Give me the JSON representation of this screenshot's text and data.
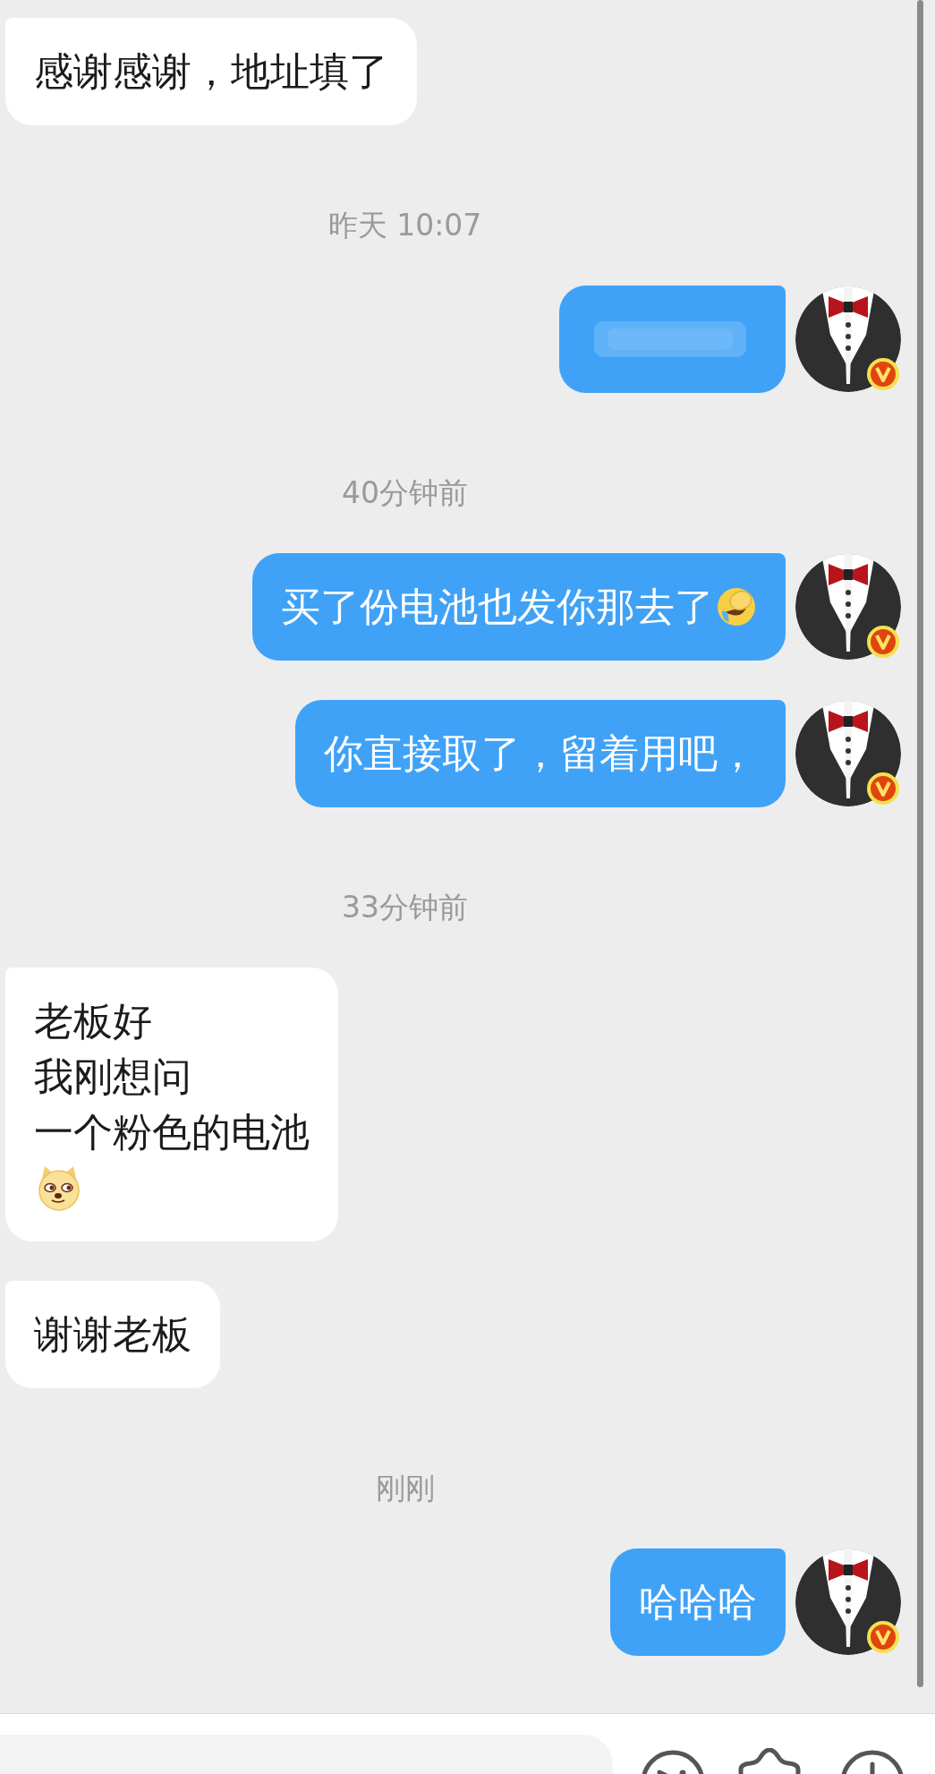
{
  "messages": [
    {
      "kind": "received",
      "blurred": false,
      "lines": [
        {
          "parts": [
            {
              "kind": "text",
              "text": "感谢感谢，地址填了"
            }
          ]
        }
      ]
    },
    {
      "kind": "time",
      "text": "昨天 10:07"
    },
    {
      "kind": "sent",
      "blurred": true
    },
    {
      "kind": "time",
      "text": "40分钟前"
    },
    {
      "kind": "sent",
      "blurred": false,
      "lines": [
        {
          "parts": [
            {
              "kind": "text",
              "text": "买了份电池也发你那去了"
            },
            {
              "kind": "laughing"
            }
          ]
        }
      ]
    },
    {
      "kind": "sent",
      "blurred": false,
      "lines": [
        {
          "parts": [
            {
              "kind": "text",
              "text": "你直接取了，留着用吧，"
            }
          ]
        }
      ]
    },
    {
      "kind": "time",
      "text": "33分钟前"
    },
    {
      "kind": "received",
      "blurred": false,
      "lines": [
        {
          "parts": [
            {
              "kind": "text",
              "text": "老板好"
            }
          ]
        },
        {
          "parts": [
            {
              "kind": "text",
              "text": "我刚想问"
            }
          ]
        },
        {
          "parts": [
            {
              "kind": "text",
              "text": "一个粉色的电池"
            }
          ]
        },
        {
          "parts": [
            {
              "kind": "dog"
            }
          ]
        }
      ]
    },
    {
      "kind": "received",
      "blurred": false,
      "lines": [
        {
          "parts": [
            {
              "kind": "text",
              "text": "谢谢老板"
            }
          ]
        }
      ]
    },
    {
      "kind": "time",
      "text": "刚刚"
    },
    {
      "kind": "sent",
      "blurred": false,
      "lines": [
        {
          "parts": [
            {
              "kind": "text",
              "text": "哈哈哈"
            }
          ]
        }
      ]
    }
  ]
}
